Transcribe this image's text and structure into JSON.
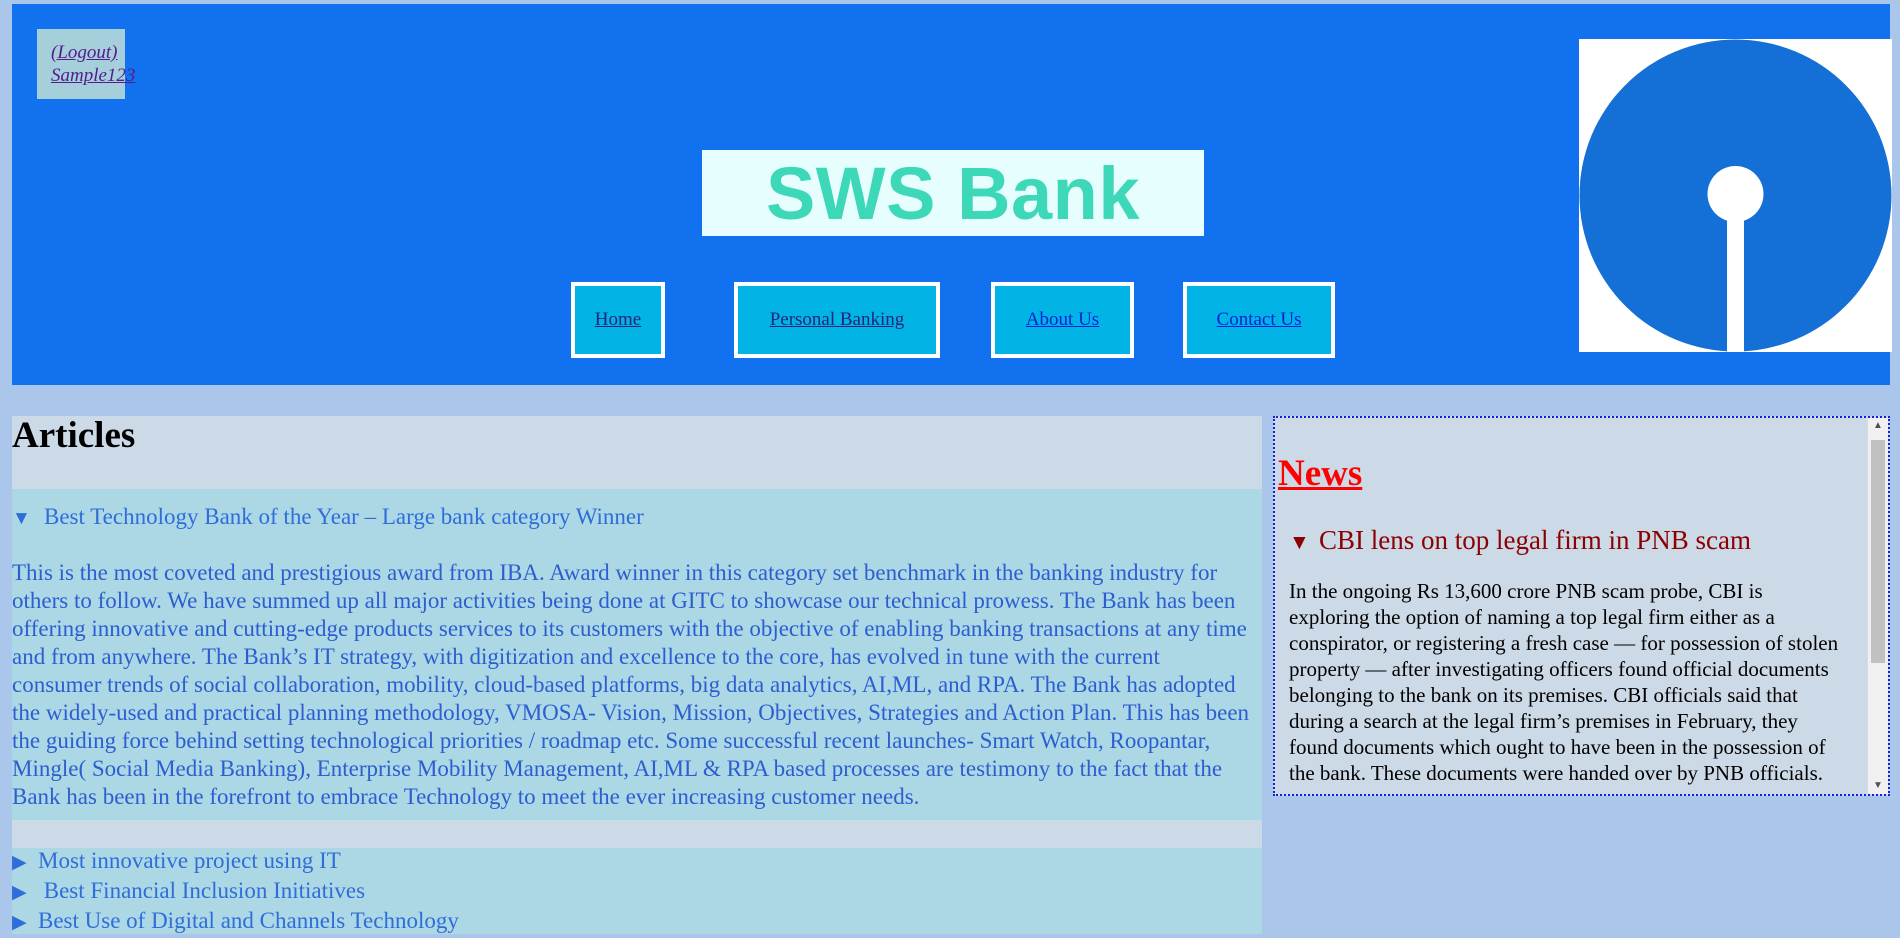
{
  "header": {
    "user_links": [
      "(Logout)",
      "Sample123"
    ],
    "title": "SWS Bank",
    "nav": [
      {
        "label": "Home "
      },
      {
        "label": "Personal Banking "
      },
      {
        "label": "About Us "
      },
      {
        "label": "Contact Us"
      }
    ],
    "logo_icon": "sbi-logo-icon",
    "colors": {
      "header_bg": "#1271ee",
      "title": "#3dd8b8",
      "nav_bg": "#02b3e5"
    }
  },
  "articles": {
    "heading": "Articles",
    "items": [
      {
        "title": "Best Technology Bank of the Year – Large bank category Winner",
        "open": true,
        "body": "This is the most coveted and prestigious award from IBA. Award winner in this category set benchmark in the banking industry for others to follow. We have summed up all major activities being done at GITC to showcase our technical prowess. The Bank has been offering innovative and cutting-edge products services to its customers with the objective of enabling banking transactions at any time and from anywhere. The Bank’s IT strategy, with digitization and excellence to the core, has evolved in tune with the current consumer trends of social collaboration, mobility, cloud-based platforms, big data analytics, AI,ML, and RPA. The Bank has adopted the widely-used and practical planning methodology, VMOSA- Vision, Mission, Objectives, Strategies and Action Plan. This has been the guiding force behind setting technological priorities / roadmap etc. Some successful recent launches- Smart Watch, Roopantar, Mingle( Social Media Banking), Enterprise Mobility Management, AI,ML & RPA based processes are testimony to the fact that the Bank has been in the forefront to embrace Technology to meet the ever increasing customer needs."
      },
      {
        "title": "Most innovative project using IT",
        "open": false
      },
      {
        "title": " Best Financial Inclusion Initiatives",
        "open": false
      },
      {
        "title": "Best Use of Digital and Channels Technology",
        "open": false
      }
    ]
  },
  "news": {
    "heading": "News",
    "item": {
      "title": "CBI lens on top legal firm in PNB scam",
      "body": "In the ongoing Rs 13,600 crore PNB scam probe, CBI is exploring the option of naming a top legal firm either as a conspirator, or registering a fresh case — for possession of stolen property — after investigating officers found official documents belonging to the bank on its premises. CBI officials said that during a search at the legal firm’s premises in February, they found documents which ought to have been in the possession of the bank. These documents were handed over by PNB officials."
    }
  }
}
